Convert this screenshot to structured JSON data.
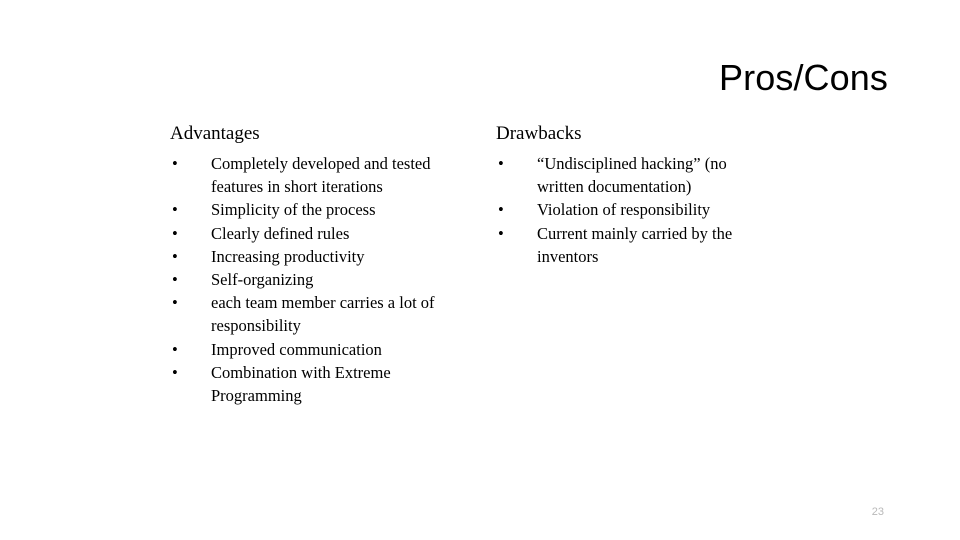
{
  "slide": {
    "title": "Pros/Cons",
    "page_number": "23",
    "background_color": "#ffffff",
    "text_color": "#000000",
    "page_number_color": "#b9b9b9",
    "bullet_glyph": "•"
  },
  "columns": {
    "left": {
      "heading": "Advantages",
      "items": [
        "Completely developed and tested features in short iterations",
        "Simplicity of the process",
        "Clearly defined rules",
        "Increasing productivity",
        "Self-organizing",
        "each team member carries a lot of responsibility",
        "Improved communication",
        "Combination with Extreme Programming"
      ]
    },
    "right": {
      "heading": "Drawbacks",
      "items": [
        "“Undisciplined hacking” (no written documentation)",
        "Violation of responsibility",
        "Current mainly carried by the inventors"
      ]
    }
  }
}
